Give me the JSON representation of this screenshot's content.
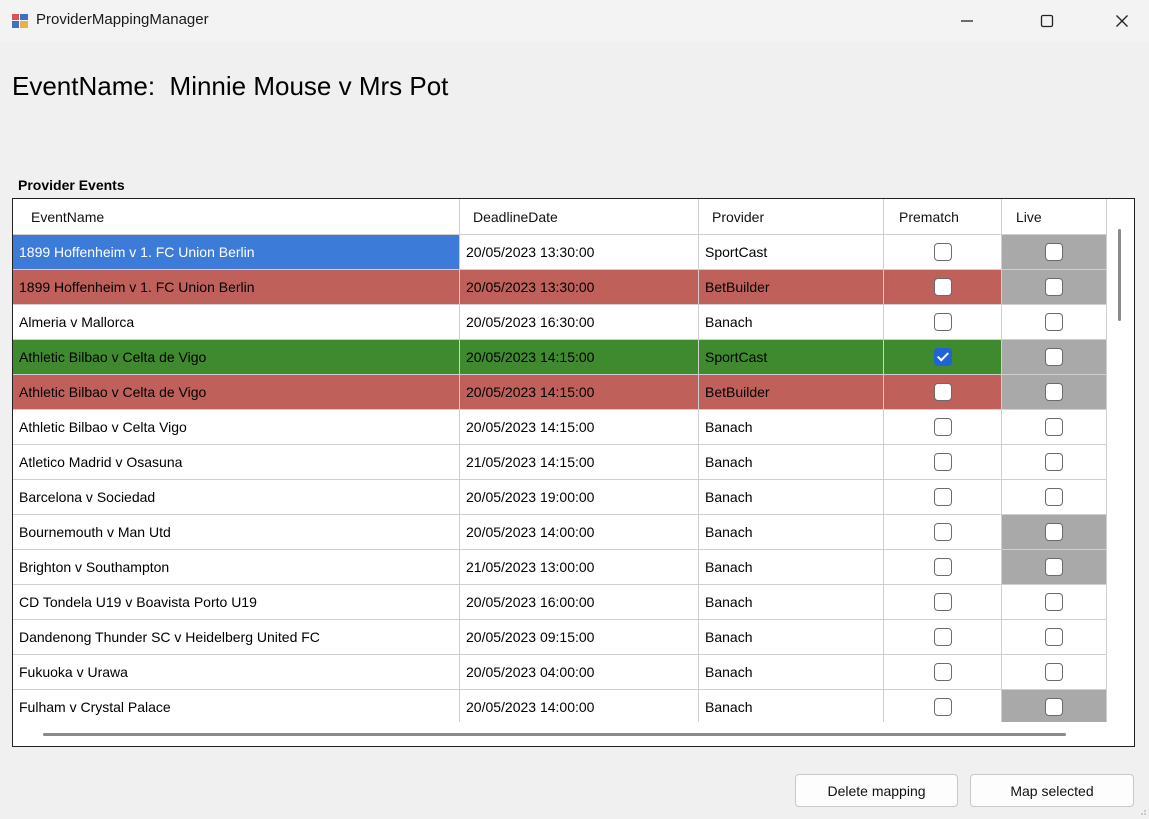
{
  "window": {
    "title": "ProviderMappingManager"
  },
  "header": {
    "event_label": "EventName:",
    "event_name": "Minnie Mouse v Mrs Pot"
  },
  "group": {
    "label": "Provider Events"
  },
  "columns": [
    "EventName",
    "DeadlineDate",
    "Provider",
    "Prematch",
    "Live"
  ],
  "colors": {
    "selected_blue": "#3d7bd8",
    "mapped_green": "#3f8a2f",
    "conflict_red": "#c0605a",
    "disabled_gray": "#a9a9a9",
    "check_blue": "#1f63d6"
  },
  "rows": [
    {
      "event": "1899 Hoffenheim v 1. FC Union Berlin",
      "date": "20/05/2023 13:30:00",
      "provider": "SportCast",
      "prematch": false,
      "live": false,
      "state": "selected",
      "live_gray": true
    },
    {
      "event": "1899 Hoffenheim v 1. FC Union Berlin",
      "date": "20/05/2023 13:30:00",
      "provider": "BetBuilder",
      "prematch": false,
      "live": false,
      "state": "red",
      "live_gray": true
    },
    {
      "event": "Almeria v Mallorca",
      "date": "20/05/2023 16:30:00",
      "provider": "Banach",
      "prematch": false,
      "live": false,
      "state": "normal",
      "live_gray": false
    },
    {
      "event": "Athletic Bilbao v Celta de Vigo",
      "date": "20/05/2023 14:15:00",
      "provider": "SportCast",
      "prematch": true,
      "live": false,
      "state": "green",
      "live_gray": true
    },
    {
      "event": "Athletic Bilbao v Celta de Vigo",
      "date": "20/05/2023 14:15:00",
      "provider": "BetBuilder",
      "prematch": false,
      "live": false,
      "state": "red",
      "live_gray": true
    },
    {
      "event": "Athletic Bilbao v Celta Vigo",
      "date": "20/05/2023 14:15:00",
      "provider": "Banach",
      "prematch": false,
      "live": false,
      "state": "normal",
      "live_gray": false
    },
    {
      "event": "Atletico Madrid v Osasuna",
      "date": "21/05/2023 14:15:00",
      "provider": "Banach",
      "prematch": false,
      "live": false,
      "state": "normal",
      "live_gray": false
    },
    {
      "event": "Barcelona v Sociedad",
      "date": "20/05/2023 19:00:00",
      "provider": "Banach",
      "prematch": false,
      "live": false,
      "state": "normal",
      "live_gray": false
    },
    {
      "event": "Bournemouth v Man Utd",
      "date": "20/05/2023 14:00:00",
      "provider": "Banach",
      "prematch": false,
      "live": false,
      "state": "normal",
      "live_gray": true
    },
    {
      "event": "Brighton v Southampton",
      "date": "21/05/2023 13:00:00",
      "provider": "Banach",
      "prematch": false,
      "live": false,
      "state": "normal",
      "live_gray": true
    },
    {
      "event": "CD Tondela U19 v Boavista Porto U19",
      "date": "20/05/2023 16:00:00",
      "provider": "Banach",
      "prematch": false,
      "live": false,
      "state": "normal",
      "live_gray": false
    },
    {
      "event": "Dandenong Thunder SC v Heidelberg United FC",
      "date": "20/05/2023 09:15:00",
      "provider": "Banach",
      "prematch": false,
      "live": false,
      "state": "normal",
      "live_gray": false
    },
    {
      "event": "Fukuoka v Urawa",
      "date": "20/05/2023 04:00:00",
      "provider": "Banach",
      "prematch": false,
      "live": false,
      "state": "normal",
      "live_gray": false
    },
    {
      "event": "Fulham v Crystal Palace",
      "date": "20/05/2023 14:00:00",
      "provider": "Banach",
      "prematch": false,
      "live": false,
      "state": "normal",
      "live_gray": true
    }
  ],
  "buttons": {
    "delete": "Delete mapping",
    "map": "Map selected"
  }
}
